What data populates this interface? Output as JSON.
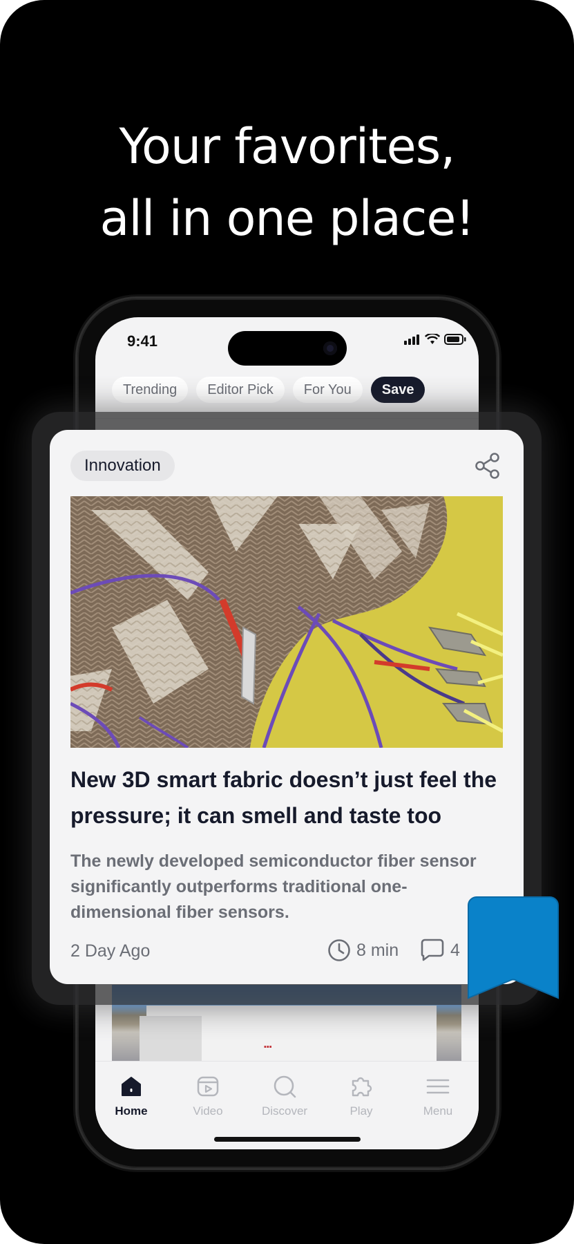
{
  "promo": {
    "headline_line1": "Your favorites,",
    "headline_line2": "all in one place!"
  },
  "status_bar": {
    "time": "9:41"
  },
  "tabs": [
    {
      "label": "Trending",
      "active": false
    },
    {
      "label": "Editor Pick",
      "active": false
    },
    {
      "label": "For You",
      "active": false
    },
    {
      "label": "Save",
      "active": true
    }
  ],
  "article": {
    "category": "Innovation",
    "title": "New 3D smart fabric doesn’t just feel the pressure; it can smell and taste too",
    "description": "The newly developed semiconductor fiber sensor significantly outperforms traditional one-dimensional fiber sensors.",
    "age": "2 Day Ago",
    "read_time": "8 min",
    "comments": "4"
  },
  "bottom_nav": [
    {
      "label": "Home",
      "icon": "home-icon",
      "active": true
    },
    {
      "label": "Video",
      "icon": "video-icon",
      "active": false
    },
    {
      "label": "Discover",
      "icon": "search-icon",
      "active": false
    },
    {
      "label": "Play",
      "icon": "puzzle-icon",
      "active": false
    },
    {
      "label": "Menu",
      "icon": "menu-icon",
      "active": false
    }
  ],
  "colors": {
    "accent": "#161a2b",
    "bookmark": "#0a82c9",
    "background": "#000000"
  }
}
